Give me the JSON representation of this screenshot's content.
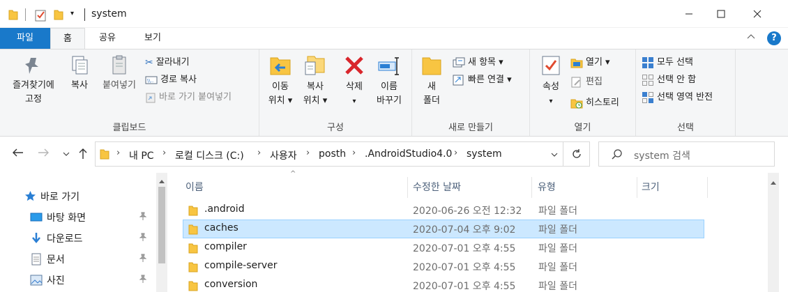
{
  "window": {
    "title": "system",
    "colors": {
      "accent": "#1979ca",
      "selection": "#cce8ff",
      "folder": "#f8c542"
    }
  },
  "ribbon_tabs": [
    "파일",
    "홈",
    "공유",
    "보기"
  ],
  "ribbon": {
    "clipboard": {
      "label": "클립보드",
      "pin_line1": "즐겨찾기에",
      "pin_line2": "고정",
      "copy": "복사",
      "paste": "붙여넣기",
      "cut": "잘라내기",
      "copy_path": "경로 복사",
      "paste_shortcut": "바로 가기 붙여넣기"
    },
    "organize": {
      "label": "구성",
      "move_line1": "이동",
      "move_line2": "위치 ▾",
      "copyto_line1": "복사",
      "copyto_line2": "위치 ▾",
      "delete": "삭제",
      "delete_arrow": "▾",
      "rename_line1": "이름",
      "rename_line2": "바꾸기"
    },
    "new": {
      "label": "새로 만들기",
      "folder_line1": "새",
      "folder_line2": "폴더",
      "new_item": "새 항목 ▾",
      "easy_access": "빠른 연결 ▾"
    },
    "open": {
      "label": "열기",
      "properties": "속성",
      "properties_arrow": "▾",
      "open": "열기 ▾",
      "edit": "편집",
      "history": "히스토리"
    },
    "select": {
      "label": "선택",
      "select_all": "모두 선택",
      "select_none": "선택 안 함",
      "invert": "선택 영역 반전"
    }
  },
  "address": {
    "breadcrumbs": [
      "내 PC",
      "로컬 디스크 (C:)",
      "사용자",
      "posth",
      ".AndroidStudio4.0",
      "system"
    ],
    "search_placeholder": "system 검색"
  },
  "nav_pane": {
    "items": [
      {
        "label": "바로 가기",
        "icon": "star-icon"
      },
      {
        "label": "바탕 화면",
        "icon": "desktop-icon"
      },
      {
        "label": "다운로드",
        "icon": "download-icon"
      },
      {
        "label": "문서",
        "icon": "documents-icon"
      },
      {
        "label": "사진",
        "icon": "pictures-icon"
      }
    ]
  },
  "file_list": {
    "columns": [
      "이름",
      "수정한 날짜",
      "유형",
      "크기"
    ],
    "rows": [
      {
        "name": ".android",
        "modified": "2020-06-26 오전 12:32",
        "type": "파일 폴더",
        "selected": false
      },
      {
        "name": "caches",
        "modified": "2020-07-04 오후 9:02",
        "type": "파일 폴더",
        "selected": true
      },
      {
        "name": "compiler",
        "modified": "2020-07-01 오후 4:55",
        "type": "파일 폴더",
        "selected": false
      },
      {
        "name": "compile-server",
        "modified": "2020-07-01 오후 4:55",
        "type": "파일 폴더",
        "selected": false
      },
      {
        "name": "conversion",
        "modified": "2020-07-01 오후 4:55",
        "type": "파일 폴더",
        "selected": false
      }
    ]
  }
}
